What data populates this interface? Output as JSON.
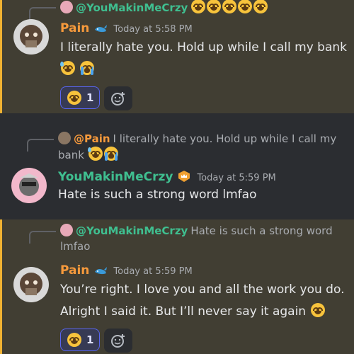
{
  "messages": [
    {
      "reply": {
        "name": "@YouMakinMeCrzy",
        "text": ""
      },
      "author": "Pain",
      "time": "Today at 5:58 PM",
      "line1": "I literally hate you. Hold up while I call my bank",
      "reaction": {
        "emoji": "joy-emoji",
        "count": "1"
      }
    },
    {
      "reply": {
        "name": "@Pain",
        "text": "I literally hate you. Hold up while I call my",
        "text2": "bank"
      },
      "author": "YouMakinMeCrzy",
      "time": "Today at 5:59 PM",
      "line1": "Hate is such a strong word lmfao"
    },
    {
      "reply": {
        "name": "@YouMakinMeCrzy",
        "text": "Hate is such a strong word",
        "text2": "lmfao"
      },
      "author": "Pain",
      "time": "Today at 5:59 PM",
      "line1": "You’re right. I love you and all the work you do.",
      "line2": "Alright I said it. But I’ll never say it again",
      "reaction": {
        "emoji": "joy-emoji",
        "count": "1"
      }
    }
  ],
  "colors": {
    "pain": "#f79a3c",
    "ymc": "#3fbf90",
    "mention_bg": "#413e33",
    "mention_bar": "#f0b232",
    "reaction_border": "#5865f2"
  }
}
